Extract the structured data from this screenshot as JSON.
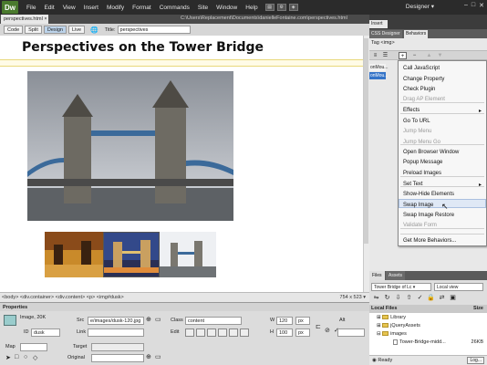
{
  "menubar": {
    "logo": "Dw",
    "items": [
      "File",
      "Edit",
      "View",
      "Insert",
      "Modify",
      "Format",
      "Commands",
      "Site",
      "Window",
      "Help"
    ],
    "workspace": "Designer ▾"
  },
  "document": {
    "tab": "perspectives.html",
    "path": "C:\\Users\\Replacement\\Documents\\danielleFontaine.com\\perspectives.html",
    "views": [
      "Code",
      "Split",
      "Design",
      "Live"
    ],
    "title_label": "Title:",
    "title_value": "perspectives"
  },
  "page": {
    "heading": "Perspectives on the Tower Bridge"
  },
  "status": {
    "tags": "<body> <div.container> <div.content> <p> <img#dusk>",
    "size": "754 x 523 ▾"
  },
  "properties": {
    "header": "Properties",
    "image_label": "Image, 20K",
    "id_label": "ID",
    "id_value": "dusk",
    "src_label": "Src",
    "src_value": "e/images/dusk-120.jpg",
    "link_label": "Link",
    "class_label": "Class",
    "class_value": "content",
    "edit_label": "Edit",
    "w_label": "W",
    "w_value": "120",
    "w_unit": "px",
    "h_label": "H",
    "h_value": "100",
    "h_unit": "px",
    "alt_label": "Alt",
    "map_label": "Map",
    "target_label": "Target",
    "original_label": "Original"
  },
  "panel": {
    "insert_tab": "Insert",
    "tabs": [
      "CSS Designer",
      "Behaviors"
    ],
    "tag_label": "Tag <img>",
    "events": [
      "onMou...",
      "onMou..."
    ]
  },
  "dropdown": {
    "items": [
      {
        "label": "Call JavaScript",
        "disabled": false
      },
      {
        "label": "Change Property",
        "disabled": false
      },
      {
        "label": "Check Plugin",
        "disabled": false
      },
      {
        "label": "Drag AP Element",
        "disabled": true
      },
      {
        "label": "Effects",
        "disabled": false,
        "submenu": true
      },
      {
        "label": "Go To URL",
        "disabled": false
      },
      {
        "label": "Jump Menu",
        "disabled": true
      },
      {
        "label": "Jump Menu Go",
        "disabled": true
      },
      {
        "label": "Open Browser Window",
        "disabled": false
      },
      {
        "label": "Popup Message",
        "disabled": false
      },
      {
        "label": "Preload Images",
        "disabled": false
      },
      {
        "label": "Set Text",
        "disabled": false,
        "submenu": true
      },
      {
        "label": "Show-Hide Elements",
        "disabled": false
      },
      {
        "label": "Swap Image",
        "disabled": false,
        "highlighted": true
      },
      {
        "label": "Swap Image Restore",
        "disabled": false
      },
      {
        "label": "Validate Form",
        "disabled": true
      },
      {
        "label": "Get More Behaviors...",
        "disabled": false
      }
    ]
  },
  "files": {
    "tabs": [
      "Files",
      "Assets"
    ],
    "site": "Tower Bridge of Lc ▾",
    "view": "Local view",
    "header": "Local Files",
    "size_header": "Size",
    "rows": [
      {
        "name": "Library",
        "type": "folder"
      },
      {
        "name": "jQueryAssets",
        "type": "folder"
      },
      {
        "name": "images",
        "type": "folder"
      },
      {
        "name": "Tower-Bridge-midd...",
        "type": "file",
        "size": "26KB"
      }
    ],
    "status": "Ready",
    "log_button": "Log..."
  },
  "colors": {
    "accent": "#3574c8",
    "logo": "#4a7a2e"
  }
}
